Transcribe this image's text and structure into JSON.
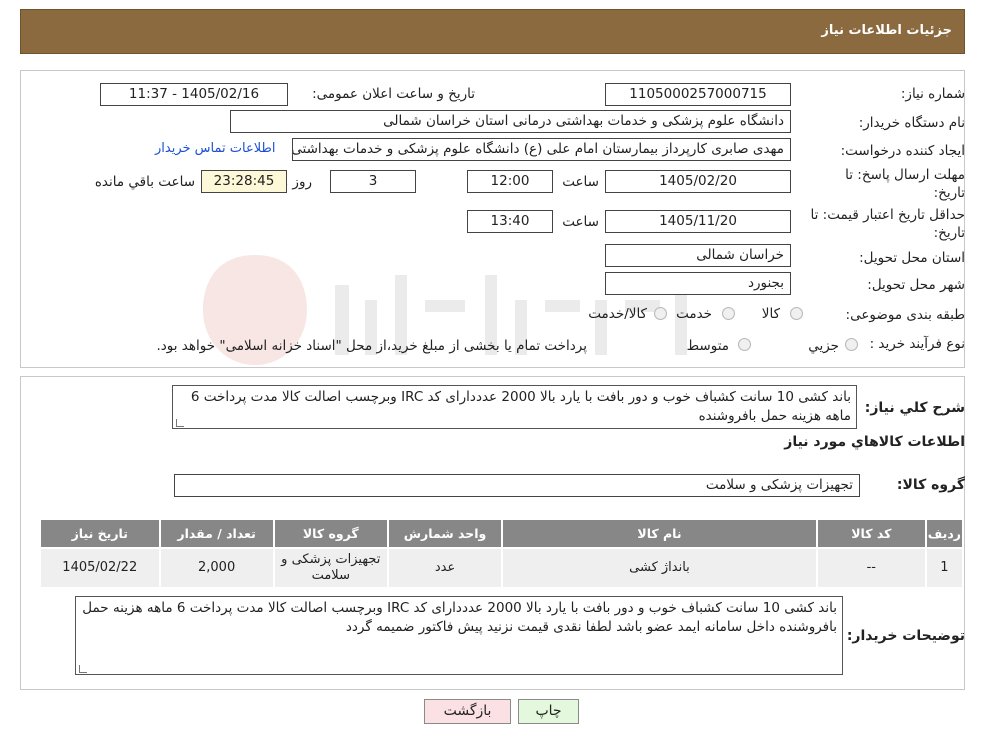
{
  "header": {
    "title": "جزئیات اطلاعات نیاز"
  },
  "form": {
    "need_number_label": "شماره نیاز:",
    "need_number": "1105000257000715",
    "announce_label": "تاریخ و ساعت اعلان عمومی:",
    "announce_value": "1405/02/16 - 11:37",
    "buyer_org_label": "نام دستگاه خریدار:",
    "buyer_org": "دانشگاه علوم پزشکی و خدمات بهداشتی درمانی استان خراسان شمالی",
    "requester_label": "ایجاد کننده درخواست:",
    "requester": "مهدی صابری کارپرداز بیمارستان امام علی (ع) دانشگاه علوم پزشکی و خدمات بهداشتی",
    "contact_link": "اطلاعات تماس خریدار",
    "deadline_label_1": "مهلت ارسال پاسخ: تا",
    "deadline_label_2": "تاریخ:",
    "deadline_date": "1405/02/20",
    "time_label": "ساعت",
    "deadline_time": "12:00",
    "days_value": "3",
    "days_label": "روز و",
    "remaining_time": "23:28:45",
    "remaining_label": "ساعت باقي مانده",
    "validity_label_1": "حداقل تاریخ اعتبار قیمت: تا",
    "validity_label_2": "تاریخ:",
    "validity_date": "1405/11/20",
    "validity_time": "13:40",
    "province_label": "استان محل تحویل:",
    "province": "خراسان شمالی",
    "city_label": "شهر محل تحویل:",
    "city": "بجنورد",
    "category_label": "طبقه بندی موضوعی:",
    "category_options": [
      "کالا",
      "خدمت",
      "کالا/خدمت"
    ],
    "process_label": "نوع فرآیند خرید :",
    "process_options": [
      "جزیي",
      "متوسط"
    ],
    "process_note": "پرداخت تمام یا بخشی از مبلغ خرید،از محل \"اسناد خزانه اسلامی\" خواهد بود."
  },
  "summary": {
    "label": "شرح کلي نياز:",
    "text": "باند کشی 10 سانت کشباف خوب و دور بافت با یارد بالا 2000 عدددارای  کد IRC وبرچسب اصالت کالا مدت پرداخت 6 ماهه هزینه حمل بافروشنده"
  },
  "goods": {
    "section_title": "اطلاعات کالاهاي مورد نياز",
    "group_label": "گروه کالا:",
    "group_value": "تجهیزات پزشکی و سلامت",
    "columns": [
      "رديف",
      "کد کالا",
      "نام کالا",
      "واحد شمارش",
      "گروه کالا",
      "تعداد / مقدار",
      "تاریخ نیاز"
    ],
    "rows": [
      [
        "1",
        "--",
        "بانداژ کشی",
        "عدد",
        "تجهیزات پزشکی و سلامت",
        "2,000",
        "1405/02/22"
      ]
    ]
  },
  "buyer_notes": {
    "label": "توضیحات خریدار:",
    "text": "باند کشی 10 سانت کشباف خوب و دور بافت با یارد بالا 2000 عدددارای  کد IRC وبرچسب اصالت کالا مدت پرداخت 6 ماهه هزینه حمل بافروشنده داخل سامانه ایمد عضو باشد لطفا نقدی قیمت نزنید  پیش فاکتور ضمیمه گردد"
  },
  "buttons": {
    "print": "چاپ",
    "back": "بازگشت"
  },
  "colors": {
    "header_bg": "#8b6a3f",
    "table_header_bg": "#878787",
    "print_bg": "#e3f8dc",
    "back_bg": "#fbe1e4"
  }
}
